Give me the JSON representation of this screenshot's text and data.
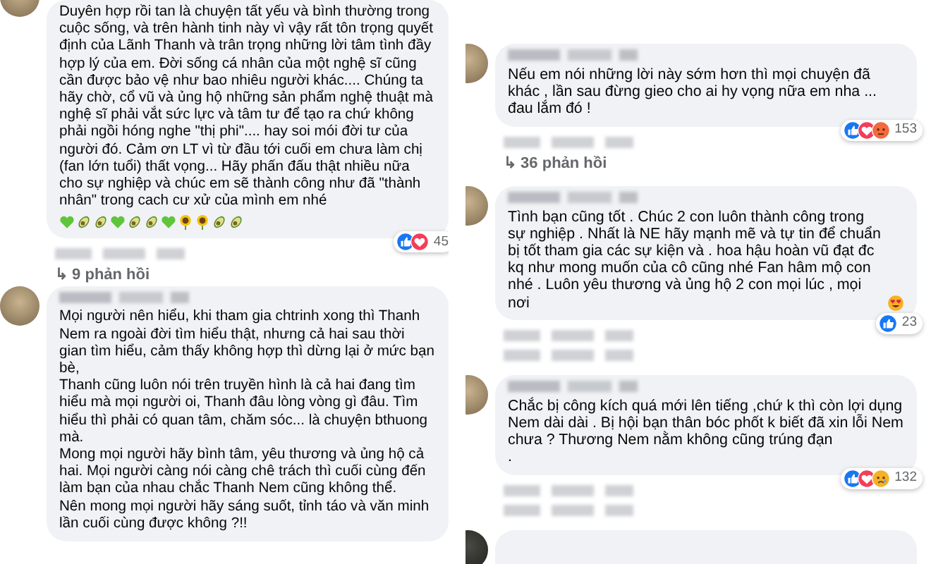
{
  "columns": [
    {
      "comments": [
        {
          "kind": "comment",
          "header": false,
          "text": "Duyên hợp rồi tan là chuyện tất yếu và bình thường trong cuộc sống, và trên hành tinh này vì vậy rất tôn trọng quyết định của Lãnh Thanh và trân trọng những lời tâm tình đầy hợp lý của em. Đời sống cá nhân của một nghệ sĩ cũng cần được bảo vệ như bao nhiêu người khác.... Chúng ta hãy chờ, cổ vũ và ủng hộ những sản phẩm nghệ thuật mà nghệ sĩ phải vắt sức lực và tâm tư để tạo ra chứ không phải ngồi hóng nghe \"thị phi\".... hay soi mói đời tư của người đó. Cảm ơn LT vì từ đầu tới cuối em chưa làm chị (fan lớn tuổi) thất vọng... Hãy phấn đấu thật nhiều nữa cho sự nghiệp và chúc em sẽ thành công như đã \"thành nhân\" trong cach cư xử của mình em nhé",
          "emojis": [
            {
              "kind": "green_heart"
            },
            {
              "kind": "avocado"
            },
            {
              "kind": "avocado"
            },
            {
              "kind": "green_heart"
            },
            {
              "kind": "avocado"
            },
            {
              "kind": "avocado"
            },
            {
              "kind": "green_heart"
            },
            {
              "kind": "sunflower"
            },
            {
              "kind": "sunflower"
            },
            {
              "kind": "avocado"
            },
            {
              "kind": "avocado"
            }
          ],
          "reactions": {
            "icons": [
              {
                "kind": "like"
              },
              {
                "kind": "love"
              }
            ],
            "count": "45"
          },
          "footer_rows": [
            {
              "kind": "blurred"
            }
          ],
          "replies": "↳ 9 phản hồi"
        },
        {
          "kind": "comment",
          "header": true,
          "text": "Mọi người nên hiểu, khi tham gia chtrinh xong thì Thanh Nem ra ngoài đời tìm hiểu thật, nhưng cả hai sau thời gian tìm hiểu, cảm thấy không hợp thì dừng lại ở mức bạn bè,\nThanh cũng luôn nói trên truyền hình là cả hai đang tìm hiểu mà mọi người oi, Thanh đâu lòng vòng gì đâu. Tìm hiểu thì phải có quan tâm, chăm sóc... là chuyện bthuong mà.\nMong mọi người hãy bình tâm, yêu thương và ủng hộ cả hai. Mọi người càng nói càng chê trách thì cuối cùng đến làm bạn của nhau chắc Thanh Nem cũng không thể.\nNên mong mọi người hãy sáng suốt, tỉnh táo và văn minh lần cuối cùng được không ?!!"
        }
      ]
    },
    {
      "comments": [
        {
          "kind": "comment",
          "header": true,
          "text": "Nếu em nói những lời này sớm hơn thì mọi chuyện đã khác , lần sau đừng gieo cho ai hy vọng nữa em nha ... đau lắm đó !",
          "reactions": {
            "icons": [
              {
                "kind": "like"
              },
              {
                "kind": "love"
              },
              {
                "kind": "angry"
              }
            ],
            "count": "153"
          },
          "footer_rows": [
            {
              "kind": "blurred"
            }
          ],
          "replies": "↳ 36 phản hồi"
        },
        {
          "kind": "comment",
          "header": true,
          "text": "Tình bạn cũng tốt . Chúc 2 con luôn thành công trong sự nghiệp . Nhất là NE hãy mạnh mẽ và tự tin để chuẩn bị tốt tham gia các sự kiện và . hoa hậu hoàn vũ đạt đc kq như mong muốn của cô cũng nhé Fan hâm mộ con nhé . Luôn yêu thương và ủng hộ 2 con mọi lúc , mọi nơi",
          "trailing_emoji": {
            "kind": "heart_eyes"
          },
          "reactions": {
            "icons": [
              {
                "kind": "like"
              }
            ],
            "count": "23"
          },
          "footer_rows": [
            {
              "kind": "blurred"
            },
            {
              "kind": "blurred"
            }
          ]
        },
        {
          "kind": "comment",
          "header": true,
          "text": "Chắc bị công kích quá mới lên tiếng ,chứ k thì còn lợi dụng Nem dài dài . Bị hội bạn thân bóc phốt k biết đã xin lỗi Nem chưa ? Thương Nem nằm không cũng trúng đạn\n.",
          "reactions": {
            "icons": [
              {
                "kind": "like"
              },
              {
                "kind": "love"
              },
              {
                "kind": "sad"
              }
            ],
            "count": "132"
          },
          "footer_rows": [
            {
              "kind": "blurred"
            },
            {
              "kind": "blurred"
            }
          ]
        },
        {
          "kind": "cut_off"
        }
      ]
    }
  ]
}
